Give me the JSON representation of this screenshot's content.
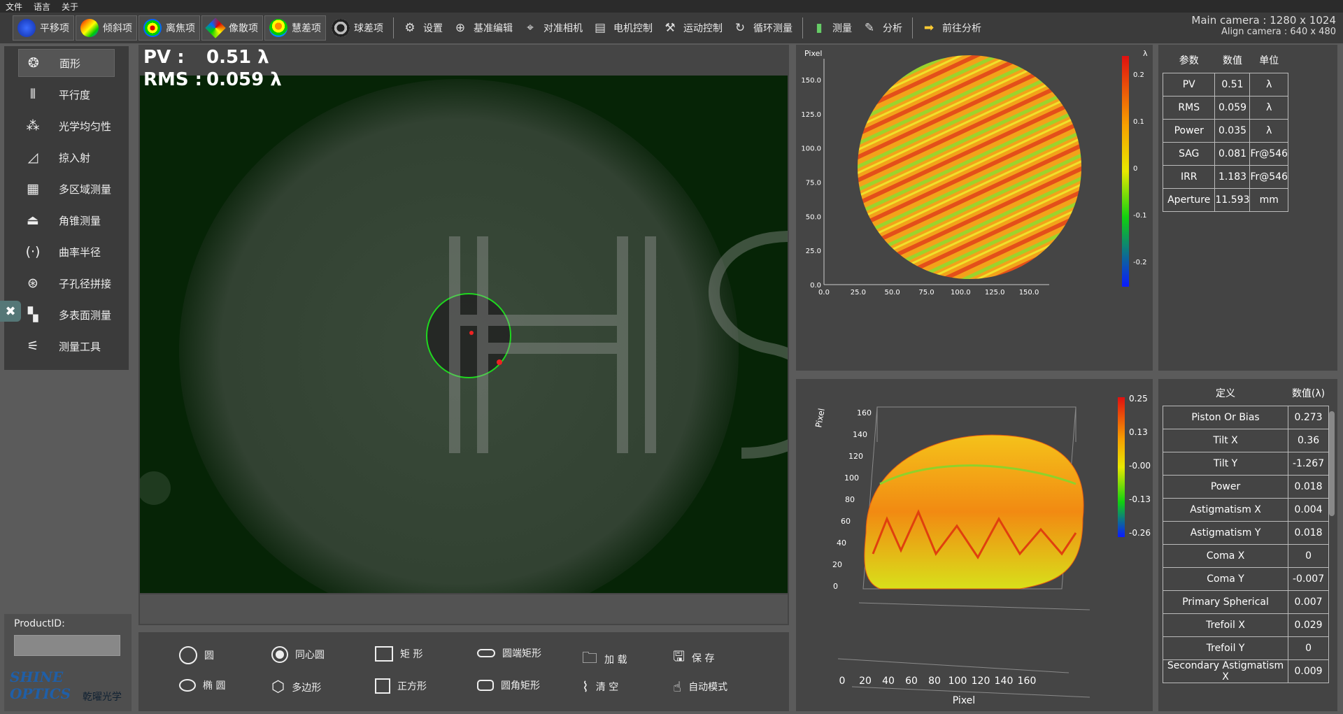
{
  "menu": [
    "文件",
    "语言",
    "关于"
  ],
  "toolbar": {
    "items": [
      {
        "label": "平移项",
        "icon": "blue-circle-icon",
        "active": true,
        "color": "#1e4fd8"
      },
      {
        "label": "倾斜项",
        "icon": "rainbow-tilt-icon",
        "active": true
      },
      {
        "label": "离焦项",
        "icon": "defocus-rings-icon",
        "active": true
      },
      {
        "label": "像散项",
        "icon": "astigmatism-icon",
        "active": true
      },
      {
        "label": "慧差项",
        "icon": "coma-icon",
        "active": true
      },
      {
        "label": "球差项",
        "icon": "spherical-icon",
        "active": false
      },
      {
        "label": "设置",
        "icon": "gear-icon"
      },
      {
        "label": "基准编辑",
        "icon": "target-icon"
      },
      {
        "label": "对准相机",
        "icon": "focus-icon"
      },
      {
        "label": "电机控制",
        "icon": "motor-icon"
      },
      {
        "label": "运动控制",
        "icon": "robot-arm-icon"
      },
      {
        "label": "循环测量",
        "icon": "cycle-icon"
      },
      {
        "label": "测量",
        "icon": "bar-chart-icon"
      },
      {
        "label": "分析",
        "icon": "edit-icon"
      },
      {
        "label": "前往分析",
        "icon": "arrow-right-icon"
      }
    ]
  },
  "camera_info": {
    "main": "Main camera : 1280 x 1024",
    "align": "Align camera : 640 x 480"
  },
  "sidebar": {
    "items": [
      {
        "label": "面形",
        "icon": "aperture-icon",
        "active": true
      },
      {
        "label": "平行度",
        "icon": "parallel-icon"
      },
      {
        "label": "光学均匀性",
        "icon": "molecule-icon"
      },
      {
        "label": "掠入射",
        "icon": "grazing-icon"
      },
      {
        "label": "多区域测量",
        "icon": "grid-icon"
      },
      {
        "label": "角锥测量",
        "icon": "pyramid-icon"
      },
      {
        "label": "曲率半径",
        "icon": "curvature-icon"
      },
      {
        "label": "子孔径拼接",
        "icon": "stitch-icon"
      },
      {
        "label": "多表面测量",
        "icon": "multi-surface-icon"
      },
      {
        "label": "测量工具",
        "icon": "tools-icon"
      }
    ]
  },
  "product": {
    "label": "ProductID:",
    "value": ""
  },
  "logo": {
    "name": "SHINE OPTICS",
    "cn": "乾曜光学"
  },
  "measure": {
    "pv_label": "PV :",
    "pv_value": "0.51 λ",
    "rms_label": "RMS :",
    "rms_value": "0.059 λ"
  },
  "watermark": "HSD",
  "tools": [
    {
      "label": "圆",
      "icon": "circle-icon"
    },
    {
      "label": "同心圆",
      "icon": "concentric-circle-icon"
    },
    {
      "label": "矩 形",
      "icon": "rectangle-icon"
    },
    {
      "label": "圆端矩形",
      "icon": "round-end-rect-icon"
    },
    {
      "label": "加 载",
      "icon": "folder-icon"
    },
    {
      "label": "保 存",
      "icon": "save-icon"
    },
    {
      "label": "椭 圆",
      "icon": "ellipse-icon"
    },
    {
      "label": "多边形",
      "icon": "polygon-icon"
    },
    {
      "label": "正方形",
      "icon": "square-icon"
    },
    {
      "label": "圆角矩形",
      "icon": "rounded-rect-icon"
    },
    {
      "label": "清 空",
      "icon": "broom-icon"
    },
    {
      "label": "自动模式",
      "icon": "hand-pointer-icon"
    }
  ],
  "params": {
    "headers": [
      "参数",
      "数值",
      "单位"
    ],
    "rows": [
      [
        "PV",
        "0.51",
        "λ"
      ],
      [
        "RMS",
        "0.059",
        "λ"
      ],
      [
        "Power",
        "0.035",
        "λ"
      ],
      [
        "SAG",
        "0.081",
        "Fr@546"
      ],
      [
        "IRR",
        "1.183",
        "Fr@546"
      ],
      [
        "Aperture",
        "11.593",
        "mm"
      ]
    ]
  },
  "zernike": {
    "headers": [
      "定义",
      "数值(λ)"
    ],
    "rows": [
      [
        "Piston Or Bias",
        "0.273"
      ],
      [
        "Tilt X",
        "0.36"
      ],
      [
        "Tilt Y",
        "-1.267"
      ],
      [
        "Power",
        "0.018"
      ],
      [
        "Astigmatism X",
        "0.004"
      ],
      [
        "Astigmatism Y",
        "0.018"
      ],
      [
        "Coma X",
        "0"
      ],
      [
        "Coma Y",
        "-0.007"
      ],
      [
        "Primary Spherical",
        "0.007"
      ],
      [
        "Trefoil X",
        "0.029"
      ],
      [
        "Trefoil Y",
        "0"
      ],
      [
        "Secondary Astigmatism X",
        "0.009"
      ]
    ]
  },
  "chart_data": [
    {
      "type": "heatmap",
      "title": "",
      "ylabel": "Pixel",
      "colorbar_label": "λ",
      "x_ticks": [
        "0.0",
        "25.0",
        "50.0",
        "75.0",
        "100.0",
        "125.0",
        "150.0"
      ],
      "y_ticks": [
        "0.0",
        "25.0",
        "50.0",
        "75.0",
        "100.0",
        "125.0",
        "150.0"
      ],
      "colorbar_ticks": [
        "0.2",
        "0.1",
        "0",
        "-0.1",
        "-0.2"
      ],
      "xlim": [
        0,
        165
      ],
      "ylim": [
        0,
        165
      ]
    },
    {
      "type": "surface3d",
      "xlabel": "Pixel",
      "ylabel": "Pixel",
      "x_ticks": [
        "0",
        "20",
        "40",
        "60",
        "80",
        "100",
        "120",
        "140",
        "160"
      ],
      "y_ticks": [
        "0",
        "20",
        "40",
        "60",
        "80",
        "100",
        "120",
        "140",
        "160"
      ],
      "colorbar_ticks": [
        "0.25",
        "0.13",
        "-0.00",
        "-0.13",
        "-0.26"
      ]
    }
  ]
}
